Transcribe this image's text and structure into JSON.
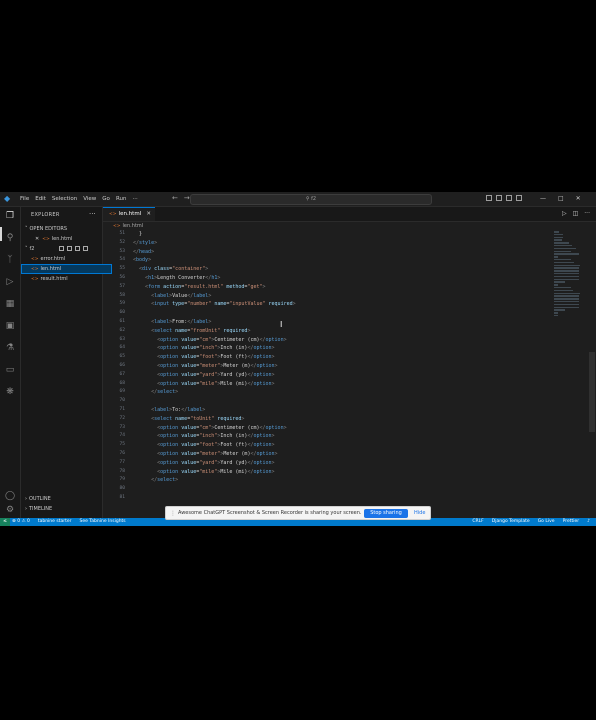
{
  "titlebar": {
    "menu": [
      "File",
      "Edit",
      "Selection",
      "View",
      "Go",
      "Run",
      "···"
    ],
    "search": "f2"
  },
  "sidebar": {
    "header": "EXPLORER",
    "open_editors": "OPEN EDITORS",
    "open_file": "len.html",
    "folder": "f2",
    "files": [
      "error.html",
      "len.html",
      "result.html"
    ],
    "outline": "OUTLINE",
    "timeline": "TIMELINE"
  },
  "editor": {
    "tab": "len.html",
    "breadcrumb": "len.html",
    "lines": [
      {
        "n": "51",
        "html": "<span class=\"tx\">  }</span>"
      },
      {
        "n": "52",
        "html": "<span class=\"tg\">&lt;/</span><span class=\"tn\">style</span><span class=\"tg\">&gt;</span>"
      },
      {
        "n": "53",
        "html": "<span class=\"tg\">&lt;/</span><span class=\"tn\">head</span><span class=\"tg\">&gt;</span>"
      },
      {
        "n": "54",
        "html": "<span class=\"tg\">&lt;</span><span class=\"tn\">body</span><span class=\"tg\">&gt;</span>"
      },
      {
        "n": "55",
        "html": "  <span class=\"tg\">&lt;</span><span class=\"tn\">div</span> <span class=\"at\">class</span>=<span class=\"st\">\"container\"</span><span class=\"tg\">&gt;</span>"
      },
      {
        "n": "56",
        "html": "    <span class=\"tg\">&lt;</span><span class=\"tn\">h1</span><span class=\"tg\">&gt;</span><span class=\"tx\">Length Converter</span><span class=\"tg\">&lt;/</span><span class=\"tn\">h1</span><span class=\"tg\">&gt;</span>"
      },
      {
        "n": "57",
        "html": "    <span class=\"tg\">&lt;</span><span class=\"tn\">form</span> <span class=\"at\">action</span>=<span class=\"st\">\"result.html\"</span> <span class=\"at\">method</span>=<span class=\"st\">\"get\"</span><span class=\"tg\">&gt;</span>"
      },
      {
        "n": "58",
        "html": "      <span class=\"tg\">&lt;</span><span class=\"tn\">label</span><span class=\"tg\">&gt;</span><span class=\"tx\">Value</span><span class=\"tg\">&lt;/</span><span class=\"tn\">label</span><span class=\"tg\">&gt;</span>"
      },
      {
        "n": "59",
        "html": "      <span class=\"tg\">&lt;</span><span class=\"tn\">input</span> <span class=\"at\">type</span>=<span class=\"st\">\"number\"</span> <span class=\"at\">name</span>=<span class=\"st\">\"inputValue\"</span> <span class=\"at\">required</span><span class=\"tg\">&gt;</span>"
      },
      {
        "n": "60",
        "html": ""
      },
      {
        "n": "61",
        "html": "      <span class=\"tg\">&lt;</span><span class=\"tn\">label</span><span class=\"tg\">&gt;</span><span class=\"tx\">From:</span><span class=\"tg\">&lt;/</span><span class=\"tn\">label</span><span class=\"tg\">&gt;</span>"
      },
      {
        "n": "62",
        "html": "      <span class=\"tg\">&lt;</span><span class=\"tn\">select</span> <span class=\"at\">name</span>=<span class=\"st\">\"fromUnit\"</span> <span class=\"at\">required</span><span class=\"tg\">&gt;</span>"
      },
      {
        "n": "63",
        "html": "        <span class=\"tg\">&lt;</span><span class=\"tn\">option</span> <span class=\"at\">value</span>=<span class=\"st\">\"cm\"</span><span class=\"tg\">&gt;</span><span class=\"tx\">Centimeter (cm)</span><span class=\"tg\">&lt;/</span><span class=\"tn\">option</span><span class=\"tg\">&gt;</span>"
      },
      {
        "n": "64",
        "html": "        <span class=\"tg\">&lt;</span><span class=\"tn\">option</span> <span class=\"at\">value</span>=<span class=\"st\">\"inch\"</span><span class=\"tg\">&gt;</span><span class=\"tx\">Inch (in)</span><span class=\"tg\">&lt;/</span><span class=\"tn\">option</span><span class=\"tg\">&gt;</span>"
      },
      {
        "n": "65",
        "html": "        <span class=\"tg\">&lt;</span><span class=\"tn\">option</span> <span class=\"at\">value</span>=<span class=\"st\">\"foot\"</span><span class=\"tg\">&gt;</span><span class=\"tx\">Foot (ft)</span><span class=\"tg\">&lt;/</span><span class=\"tn\">option</span><span class=\"tg\">&gt;</span>"
      },
      {
        "n": "66",
        "html": "        <span class=\"tg\">&lt;</span><span class=\"tn\">option</span> <span class=\"at\">value</span>=<span class=\"st\">\"meter\"</span><span class=\"tg\">&gt;</span><span class=\"tx\">Meter (m)</span><span class=\"tg\">&lt;/</span><span class=\"tn\">option</span><span class=\"tg\">&gt;</span>"
      },
      {
        "n": "67",
        "html": "        <span class=\"tg\">&lt;</span><span class=\"tn\">option</span> <span class=\"at\">value</span>=<span class=\"st\">\"yard\"</span><span class=\"tg\">&gt;</span><span class=\"tx\">Yard (yd)</span><span class=\"tg\">&lt;/</span><span class=\"tn\">option</span><span class=\"tg\">&gt;</span>"
      },
      {
        "n": "68",
        "html": "        <span class=\"tg\">&lt;</span><span class=\"tn\">option</span> <span class=\"at\">value</span>=<span class=\"st\">\"mile\"</span><span class=\"tg\">&gt;</span><span class=\"tx\">Mile (mi)</span><span class=\"tg\">&lt;/</span><span class=\"tn\">option</span><span class=\"tg\">&gt;</span>"
      },
      {
        "n": "69",
        "html": "      <span class=\"tg\">&lt;/</span><span class=\"tn\">select</span><span class=\"tg\">&gt;</span>"
      },
      {
        "n": "70",
        "html": ""
      },
      {
        "n": "71",
        "html": "      <span class=\"tg\">&lt;</span><span class=\"tn\">label</span><span class=\"tg\">&gt;</span><span class=\"tx\">To:</span><span class=\"tg\">&lt;/</span><span class=\"tn\">label</span><span class=\"tg\">&gt;</span>"
      },
      {
        "n": "72",
        "html": "      <span class=\"tg\">&lt;</span><span class=\"tn\">select</span> <span class=\"at\">name</span>=<span class=\"st\">\"toUnit\"</span> <span class=\"at\">required</span><span class=\"tg\">&gt;</span>"
      },
      {
        "n": "73",
        "html": "        <span class=\"tg\">&lt;</span><span class=\"tn\">option</span> <span class=\"at\">value</span>=<span class=\"st\">\"cm\"</span><span class=\"tg\">&gt;</span><span class=\"tx\">Centimeter (cm)</span><span class=\"tg\">&lt;/</span><span class=\"tn\">option</span><span class=\"tg\">&gt;</span>"
      },
      {
        "n": "74",
        "html": "        <span class=\"tg\">&lt;</span><span class=\"tn\">option</span> <span class=\"at\">value</span>=<span class=\"st\">\"inch\"</span><span class=\"tg\">&gt;</span><span class=\"tx\">Inch (in)</span><span class=\"tg\">&lt;/</span><span class=\"tn\">option</span><span class=\"tg\">&gt;</span>"
      },
      {
        "n": "75",
        "html": "        <span class=\"tg\">&lt;</span><span class=\"tn\">option</span> <span class=\"at\">value</span>=<span class=\"st\">\"foot\"</span><span class=\"tg\">&gt;</span><span class=\"tx\">Foot (ft)</span><span class=\"tg\">&lt;/</span><span class=\"tn\">option</span><span class=\"tg\">&gt;</span>"
      },
      {
        "n": "76",
        "html": "        <span class=\"tg\">&lt;</span><span class=\"tn\">option</span> <span class=\"at\">value</span>=<span class=\"st\">\"meter\"</span><span class=\"tg\">&gt;</span><span class=\"tx\">Meter (m)</span><span class=\"tg\">&lt;/</span><span class=\"tn\">option</span><span class=\"tg\">&gt;</span>"
      },
      {
        "n": "77",
        "html": "        <span class=\"tg\">&lt;</span><span class=\"tn\">option</span> <span class=\"at\">value</span>=<span class=\"st\">\"yard\"</span><span class=\"tg\">&gt;</span><span class=\"tx\">Yard (yd)</span><span class=\"tg\">&lt;/</span><span class=\"tn\">option</span><span class=\"tg\">&gt;</span>"
      },
      {
        "n": "78",
        "html": "        <span class=\"tg\">&lt;</span><span class=\"tn\">option</span> <span class=\"at\">value</span>=<span class=\"st\">\"mile\"</span><span class=\"tg\">&gt;</span><span class=\"tx\">Mile (mi)</span><span class=\"tg\">&lt;/</span><span class=\"tn\">option</span><span class=\"tg\">&gt;</span>"
      },
      {
        "n": "79",
        "html": "      <span class=\"tg\">&lt;/</span><span class=\"tn\">select</span><span class=\"tg\">&gt;</span>"
      },
      {
        "n": "80",
        "html": ""
      },
      {
        "n": "81",
        "html": ""
      }
    ]
  },
  "statusbar": {
    "problems": "⊗ 0 ⚠ 0",
    "tabnine": "tabnine starter",
    "insights": "See Tabnine Insights",
    "right": [
      "CRLF",
      "Django Template",
      "Go Live",
      "Prettier"
    ]
  },
  "share": {
    "text": "Awesome ChatGPT Screenshot & Screen Recorder is sharing your screen.",
    "stop": "Stop sharing",
    "hide": "Hide"
  }
}
